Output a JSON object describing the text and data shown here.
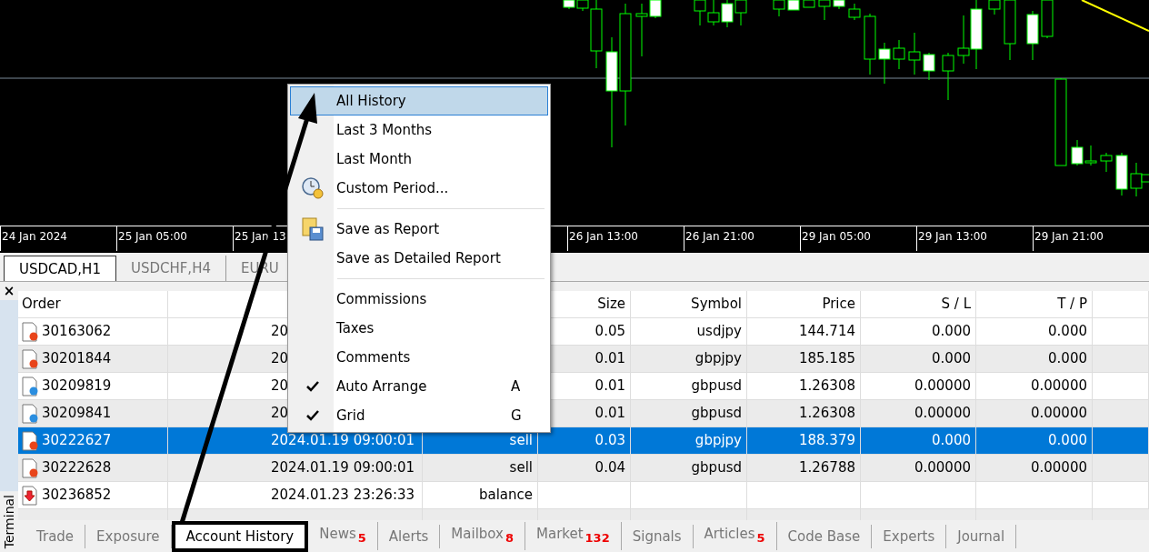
{
  "chart": {
    "time_axis": {
      "left": [
        "24 Jan 2024",
        "25 Jan 05:00",
        "25 Jan 13"
      ],
      "right": [
        "26 Jan 13:00",
        "26 Jan 21:00",
        "29 Jan 05:00",
        "29 Jan 13:00",
        "29 Jan 21:00"
      ]
    }
  },
  "chart_tabs": [
    {
      "label": "USDCAD,H1",
      "selected": true
    },
    {
      "label": "USDCHF,H4",
      "selected": false
    },
    {
      "label": "EURU",
      "selected": false
    }
  ],
  "terminal": {
    "close": "×",
    "title": "Terminal"
  },
  "table": {
    "columns": [
      "Order",
      null,
      null,
      "Size",
      "Symbol",
      "Price",
      "S / L",
      "T / P"
    ],
    "rows": [
      {
        "kind": "sell",
        "order": "30163062",
        "time": "20",
        "size": "0.05",
        "symbol": "usdjpy",
        "price": "144.714",
        "sl": "0.000",
        "tp": "0.000",
        "selected": false
      },
      {
        "kind": "sell",
        "order": "30201844",
        "time": "20",
        "size": "0.01",
        "symbol": "gbpjpy",
        "price": "185.185",
        "sl": "0.000",
        "tp": "0.000",
        "selected": false
      },
      {
        "kind": "buy",
        "order": "30209819",
        "time": "20",
        "size": "0.01",
        "symbol": "gbpusd",
        "price": "1.26308",
        "sl": "0.00000",
        "tp": "0.00000",
        "selected": false
      },
      {
        "kind": "buy",
        "order": "30209841",
        "time": "20",
        "size": "0.01",
        "symbol": "gbpusd",
        "price": "1.26308",
        "sl": "0.00000",
        "tp": "0.00000",
        "selected": false
      },
      {
        "kind": "sell",
        "order": "30222627",
        "time": "2024.01.19 09:00:01",
        "deal": "sell",
        "size": "0.03",
        "symbol": "gbpjpy",
        "price": "188.379",
        "sl": "0.000",
        "tp": "0.000",
        "selected": true
      },
      {
        "kind": "sell",
        "order": "30222628",
        "time": "2024.01.19 09:00:01",
        "deal": "sell",
        "size": "0.04",
        "symbol": "gbpusd",
        "price": "1.26788",
        "sl": "0.00000",
        "tp": "0.00000",
        "selected": false
      },
      {
        "kind": "balance",
        "order": "30236852",
        "time": "2024.01.23 23:26:33",
        "deal": "balance",
        "selected": false
      }
    ]
  },
  "bottom_tabs": [
    {
      "label": "Trade",
      "selected": false
    },
    {
      "label": "Exposure",
      "selected": false
    },
    {
      "label": "Account History",
      "selected": true,
      "highlighted": true
    },
    {
      "label": "News",
      "count": "5",
      "selected": false
    },
    {
      "label": "Alerts",
      "selected": false
    },
    {
      "label": "Mailbox",
      "count": "8",
      "selected": false
    },
    {
      "label": "Market",
      "count": "132",
      "selected": false
    },
    {
      "label": "Signals",
      "selected": false
    },
    {
      "label": "Articles",
      "count": "5",
      "selected": false
    },
    {
      "label": "Code Base",
      "selected": false
    },
    {
      "label": "Experts",
      "selected": false
    },
    {
      "label": "Journal",
      "selected": false
    }
  ],
  "context_menu": [
    {
      "kind": "item",
      "label": "All History",
      "selected": true
    },
    {
      "kind": "item",
      "label": "Last 3 Months",
      "selected": false
    },
    {
      "kind": "item",
      "label": "Last Month",
      "selected": false
    },
    {
      "kind": "clock",
      "label": "Custom Period...",
      "selected": false
    },
    {
      "kind": "separator"
    },
    {
      "kind": "save",
      "label": "Save as Report",
      "selected": false
    },
    {
      "kind": "item",
      "label": "Save as Detailed Report",
      "selected": false
    },
    {
      "kind": "separator"
    },
    {
      "kind": "item",
      "label": "Commissions",
      "selected": false
    },
    {
      "kind": "item",
      "label": "Taxes",
      "selected": false
    },
    {
      "kind": "item",
      "label": "Comments",
      "selected": false
    },
    {
      "kind": "item",
      "label": "Auto Arrange",
      "checked": true,
      "shortcut": "A",
      "selected": false
    },
    {
      "kind": "item",
      "label": "Grid",
      "checked": true,
      "shortcut": "G",
      "selected": false
    }
  ]
}
